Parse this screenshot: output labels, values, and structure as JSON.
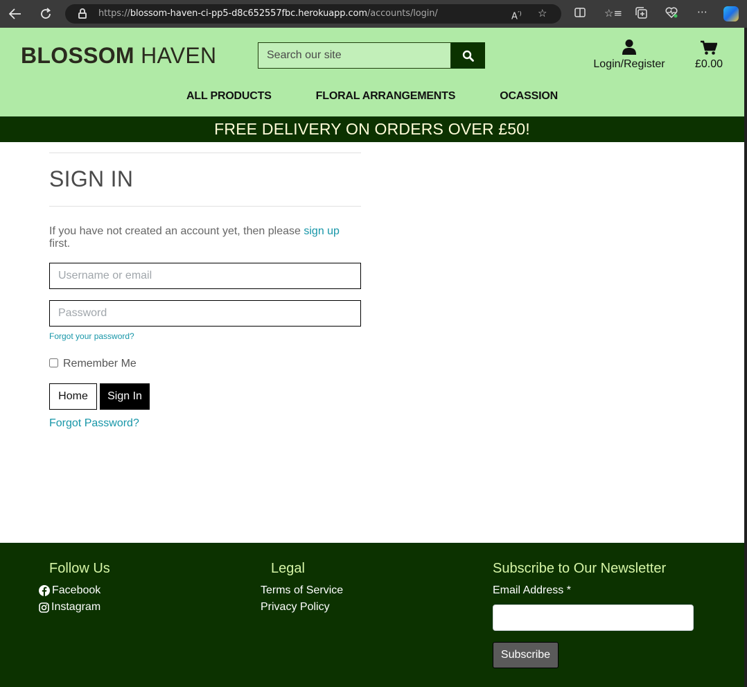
{
  "browser": {
    "url_prefix": "https://",
    "url_host": "blossom-haven-ci-pp5-d8c652557fbc.herokuapp.com",
    "url_path": "/accounts/login/"
  },
  "header": {
    "logo_bold": "BLOSSOM",
    "logo_light": "HAVEN",
    "search_placeholder": "Search our site",
    "account_label": "Login/Register",
    "cart_total": "£0.00",
    "nav": [
      "ALL PRODUCTS",
      "FLORAL ARRANGEMENTS",
      "OCASSION"
    ]
  },
  "banner": {
    "text": "FREE DELIVERY ON ORDERS OVER £50!"
  },
  "signin": {
    "title": "SIGN IN",
    "intro_before": "If you have not created an account yet, then please ",
    "intro_link": "sign up",
    "intro_after": " first.",
    "username_placeholder": "Username or email",
    "password_placeholder": "Password",
    "forgot_small": "Forgot your password?",
    "remember_label": "Remember Me",
    "home_button": "Home",
    "signin_button": "Sign In",
    "forgot_big": "Forgot Password?"
  },
  "footer": {
    "follow_heading": "Follow Us",
    "facebook": "Facebook",
    "instagram": "Instagram",
    "legal_heading": "Legal",
    "terms": "Terms of Service",
    "privacy": "Privacy Policy",
    "newsletter_heading": "Subscribe to Our Newsletter",
    "email_label": "Email Address *",
    "subscribe_button": "Subscribe"
  }
}
